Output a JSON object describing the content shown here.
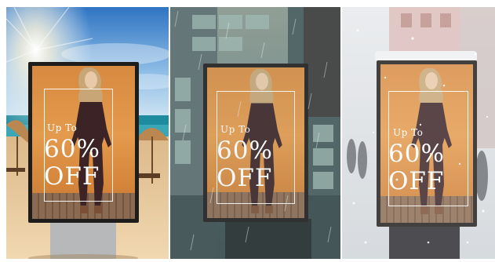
{
  "panels": [
    {
      "scene": "beach",
      "poster": {
        "up_to": "Up To",
        "discount": "60%",
        "off": "OFF"
      }
    },
    {
      "scene": "rain-city",
      "poster": {
        "up_to": "Up To",
        "discount": "60%",
        "off": "OFF"
      }
    },
    {
      "scene": "snow-street",
      "poster": {
        "up_to": "Up To",
        "discount": "60%",
        "off": "OFF"
      }
    }
  ],
  "colors": {
    "poster_orange": "#e49a4c",
    "poster_frame": "#1f1d1c",
    "sky_blue": "#4c90d2",
    "sand": "#e8c89a",
    "rain_teal": "#5d7b80",
    "snow_grey": "#dfe3e6"
  }
}
